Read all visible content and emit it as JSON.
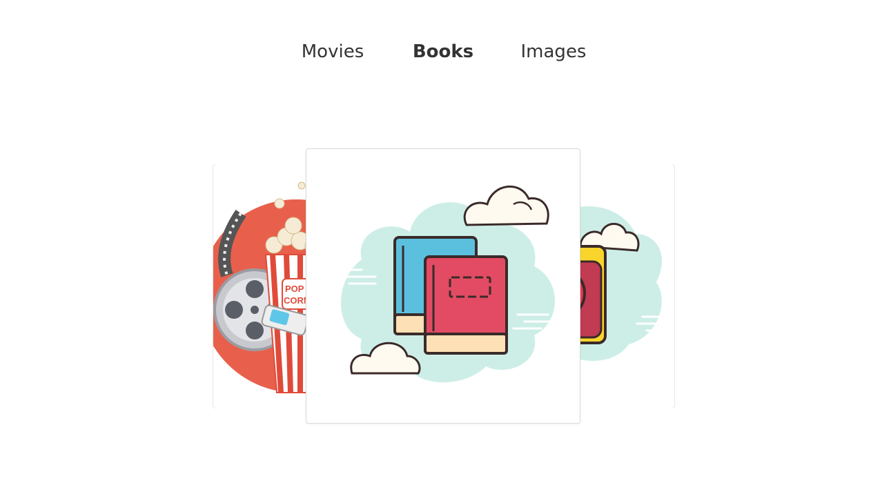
{
  "tabs": [
    {
      "label": "Movies",
      "active": false
    },
    {
      "label": "Books",
      "active": true
    },
    {
      "label": "Images",
      "active": false
    }
  ],
  "carousel": {
    "slides": [
      {
        "name": "movies-slide",
        "icon": "popcorn-film-reel-icon"
      },
      {
        "name": "books-slide",
        "icon": "books-icon"
      },
      {
        "name": "images-slide",
        "icon": "camera-icon"
      }
    ],
    "active_index": 1,
    "popcorn_text": "POP CORN"
  },
  "colors": {
    "text": "#333333",
    "card_border": "#d9d9d9",
    "cloud_bg": "#cdeee7",
    "book_blue": "#5bc0de",
    "book_red": "#e24b63",
    "book_pages": "#fde0b5",
    "movie_red": "#e8604c",
    "camera_yellow": "#f9d52b"
  }
}
